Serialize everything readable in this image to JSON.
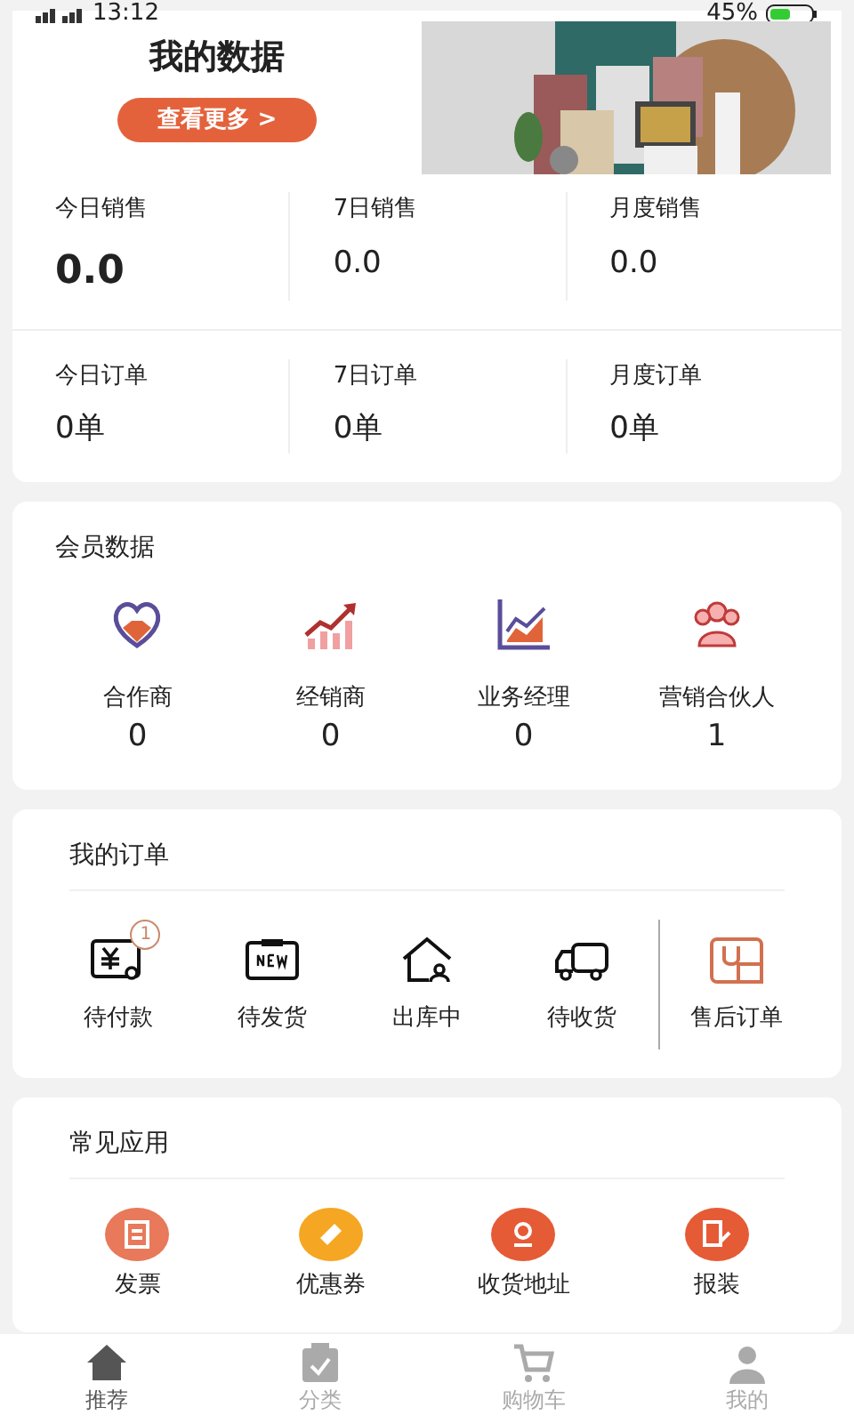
{
  "status_bar": {
    "time": "13:12",
    "battery": "45%"
  },
  "banner": {
    "title": "我的数据",
    "button": "查看更多 >",
    "kind": "picture"
  },
  "sales": [
    {
      "label": "今日销售",
      "value": "0.0",
      "emphasis": true
    },
    {
      "label": "7日销售",
      "value": "0.0",
      "emphasis": false
    },
    {
      "label": "月度销售",
      "value": "0.0",
      "emphasis": false
    }
  ],
  "orders_stats": [
    {
      "label": "今日订单",
      "value": "0单"
    },
    {
      "label": "7日订单",
      "value": "0单"
    },
    {
      "label": "月度订单",
      "value": "0单"
    }
  ],
  "members": {
    "title": "会员数据",
    "items": [
      {
        "kind": "handshake",
        "label": "合作商",
        "value": "0"
      },
      {
        "kind": "growth",
        "label": "经销商",
        "value": "0"
      },
      {
        "kind": "chart",
        "label": "业务经理",
        "value": "0"
      },
      {
        "kind": "people",
        "label": "营销合伙人",
        "value": "1"
      }
    ]
  },
  "my_orders": {
    "title": "我的订单",
    "items": [
      {
        "kind": "payment",
        "label": "待付款",
        "badge": "1"
      },
      {
        "kind": "new",
        "label": "待发货"
      },
      {
        "kind": "house",
        "label": "出库中"
      },
      {
        "kind": "truck",
        "label": "待收货"
      },
      {
        "kind": "aftersale",
        "label": "售后订单"
      }
    ]
  },
  "apps": {
    "title": "常见应用",
    "items": [
      {
        "kind": "invoice",
        "label": "发票",
        "color": "#e8795a"
      },
      {
        "kind": "coupon",
        "label": "优惠券",
        "color": "#f5a623"
      },
      {
        "kind": "address",
        "label": "收货地址",
        "color": "#e55b35"
      },
      {
        "kind": "install",
        "label": "报装",
        "color": "#e55b35"
      }
    ]
  },
  "tab_bar": [
    {
      "kind": "home",
      "label": "推荐",
      "selected": true
    },
    {
      "kind": "category",
      "label": "分类",
      "selected": false
    },
    {
      "kind": "cart",
      "label": "购物车",
      "selected": false
    },
    {
      "kind": "user",
      "label": "我的",
      "selected": false
    }
  ]
}
